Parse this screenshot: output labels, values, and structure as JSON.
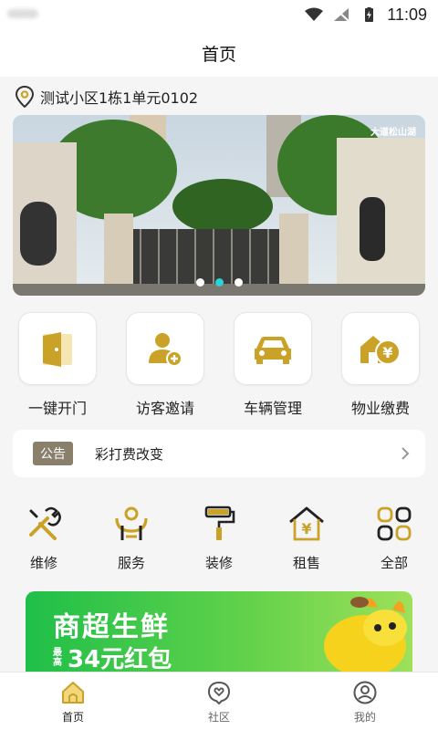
{
  "status_bar": {
    "time": "11:09"
  },
  "header": {
    "title": "首页"
  },
  "location": {
    "address": "测试小区1栋1单元0102",
    "icon": "location-pin-icon"
  },
  "banner": {
    "watermark": "大道松山湖",
    "dots": 3,
    "active_dot": 2
  },
  "quick_actions": [
    {
      "label": "一键开门",
      "icon": "door-icon"
    },
    {
      "label": "访客邀请",
      "icon": "add-user-icon"
    },
    {
      "label": "车辆管理",
      "icon": "car-icon"
    },
    {
      "label": "物业缴费",
      "icon": "property-payment-icon"
    }
  ],
  "notice": {
    "tag": "公告",
    "text": "彩打费改变"
  },
  "services": [
    {
      "label": "维修",
      "icon": "repair-tools-icon"
    },
    {
      "label": "服务",
      "icon": "service-icon"
    },
    {
      "label": "装修",
      "icon": "paint-roller-icon"
    },
    {
      "label": "租售",
      "icon": "rent-house-icon"
    },
    {
      "label": "全部",
      "icon": "all-grid-icon"
    }
  ],
  "promo": {
    "headline": "商超生鲜",
    "sub_small": "最高",
    "sub_big": "34元红包"
  },
  "tab_bar": [
    {
      "label": "首页",
      "icon": "home-icon",
      "active": true
    },
    {
      "label": "社区",
      "icon": "community-icon",
      "active": false
    },
    {
      "label": "我的",
      "icon": "profile-icon",
      "active": false
    }
  ],
  "colors": {
    "accent_gold": "#c9a227",
    "notice_tag": "#8a7f6b",
    "dot_active": "#2ad4d4"
  }
}
